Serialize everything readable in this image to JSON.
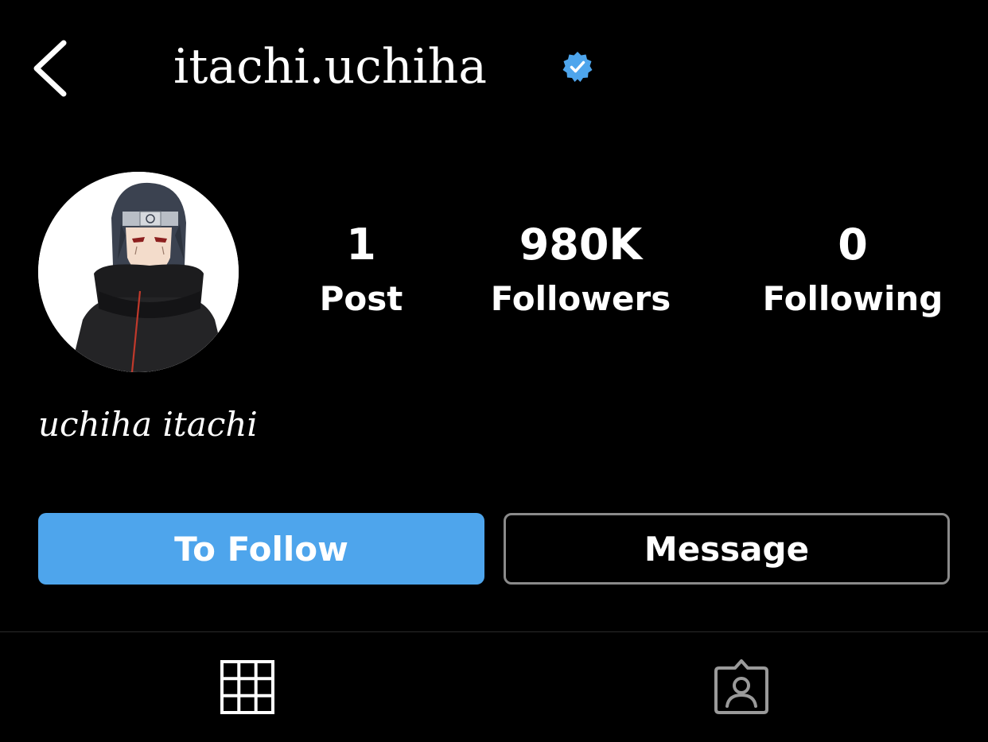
{
  "header": {
    "back_icon": "chevron-left-icon",
    "username": "itachi.uchiha",
    "verified_icon": "verified-badge-icon",
    "verified_color": "#4ea5ec"
  },
  "profile": {
    "avatar_icon": "profile-avatar",
    "display_name": "uchiha itachi"
  },
  "stats": [
    {
      "value": "1",
      "label": "Post"
    },
    {
      "value": "980K",
      "label": "Followers"
    },
    {
      "value": "0",
      "label": "Following"
    }
  ],
  "actions": {
    "follow_label": "To Follow",
    "follow_color": "#4ea5ec",
    "message_label": "Message"
  },
  "tabs": [
    {
      "icon": "grid-icon",
      "active": true
    },
    {
      "icon": "tagged-person-icon",
      "active": false
    }
  ]
}
